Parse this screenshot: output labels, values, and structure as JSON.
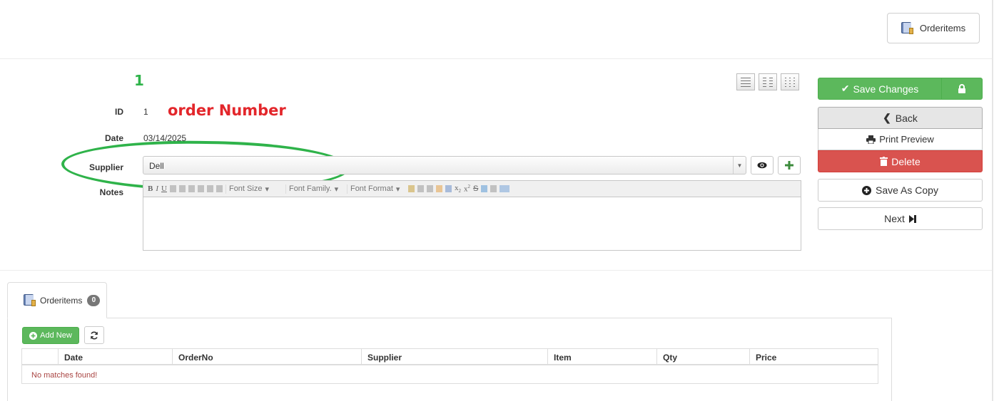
{
  "header": {
    "orderitems_button_label": "Orderitems",
    "orderitems_icon": "book-icon"
  },
  "annotations": {
    "number_label": "1",
    "order_number_label": "order Number",
    "highlight_color": "#2fb34a",
    "red_color": "#e3262b"
  },
  "form": {
    "id_label": "ID",
    "id_value": "1",
    "date_label": "Date",
    "date_value": "03/14/2025",
    "supplier_label": "Supplier",
    "supplier_value": "Dell",
    "notes_label": "Notes",
    "supplier_view_icon": "eye-icon",
    "supplier_add_icon": "plus-icon",
    "editor_toolbar": {
      "font_size_label": "Font Size",
      "font_family_label": "Font Family.",
      "font_format_label": "Font Format"
    }
  },
  "actions": {
    "save_label": "Save Changes",
    "back_label": "Back",
    "print_label": "Print Preview",
    "delete_label": "Delete",
    "save_copy_label": "Save As Copy",
    "next_label": "Next",
    "colors": {
      "save": "#5cb85c",
      "delete": "#d9534f",
      "back": "#e6e6e6"
    }
  },
  "details": {
    "tab_label": "Orderitems",
    "tab_count": "0",
    "add_new_label": "Add New",
    "columns": [
      "Date",
      "OrderNo",
      "Supplier",
      "Item",
      "Qty",
      "Price"
    ],
    "empty_message": "No matches found!"
  }
}
